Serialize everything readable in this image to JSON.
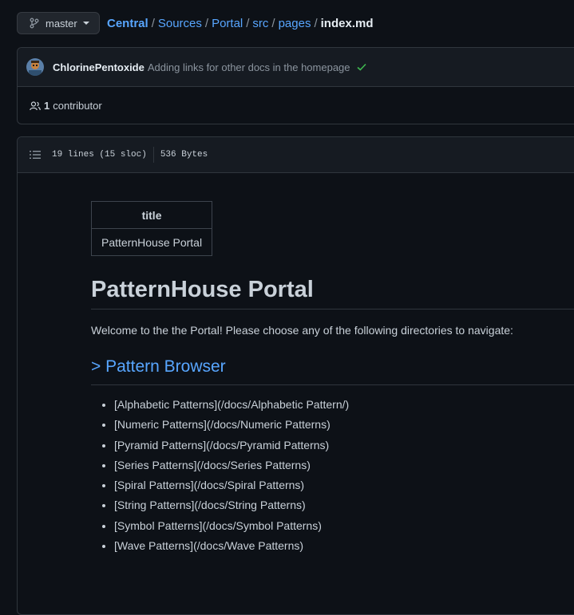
{
  "branch": {
    "name": "master"
  },
  "breadcrumb": {
    "items": [
      "Central",
      "Sources",
      "Portal",
      "src",
      "pages"
    ],
    "current": "index.md",
    "separator": "/"
  },
  "commit": {
    "author": "ChlorinePentoxide",
    "message": "Adding links for other docs in the homepage"
  },
  "contributors": {
    "count": "1",
    "label": "contributor"
  },
  "file_info": {
    "lines": "19 lines (15 sloc)",
    "size": "536 Bytes"
  },
  "frontmatter": {
    "header": "title",
    "value": "PatternHouse Portal"
  },
  "content": {
    "heading": "PatternHouse Portal",
    "intro": "Welcome to the the Portal! Please choose any of the following directories to navigate:",
    "section_heading": "> Pattern Browser",
    "links": [
      "[Alphabetic Patterns](/docs/Alphabetic Pattern/)",
      "[Numeric Patterns](/docs/Numeric Patterns)",
      "[Pyramid Patterns](/docs/Pyramid Patterns)",
      "[Series Patterns](/docs/Series Patterns)",
      "[Spiral Patterns](/docs/Spiral Patterns)",
      "[String Patterns](/docs/String Patterns)",
      "[Symbol Patterns](/docs/Symbol Patterns)",
      "[Wave Patterns](/docs/Wave Patterns)"
    ]
  },
  "colors": {
    "background": "#0d1117",
    "link": "#58a6ff",
    "success": "#3fb950"
  }
}
